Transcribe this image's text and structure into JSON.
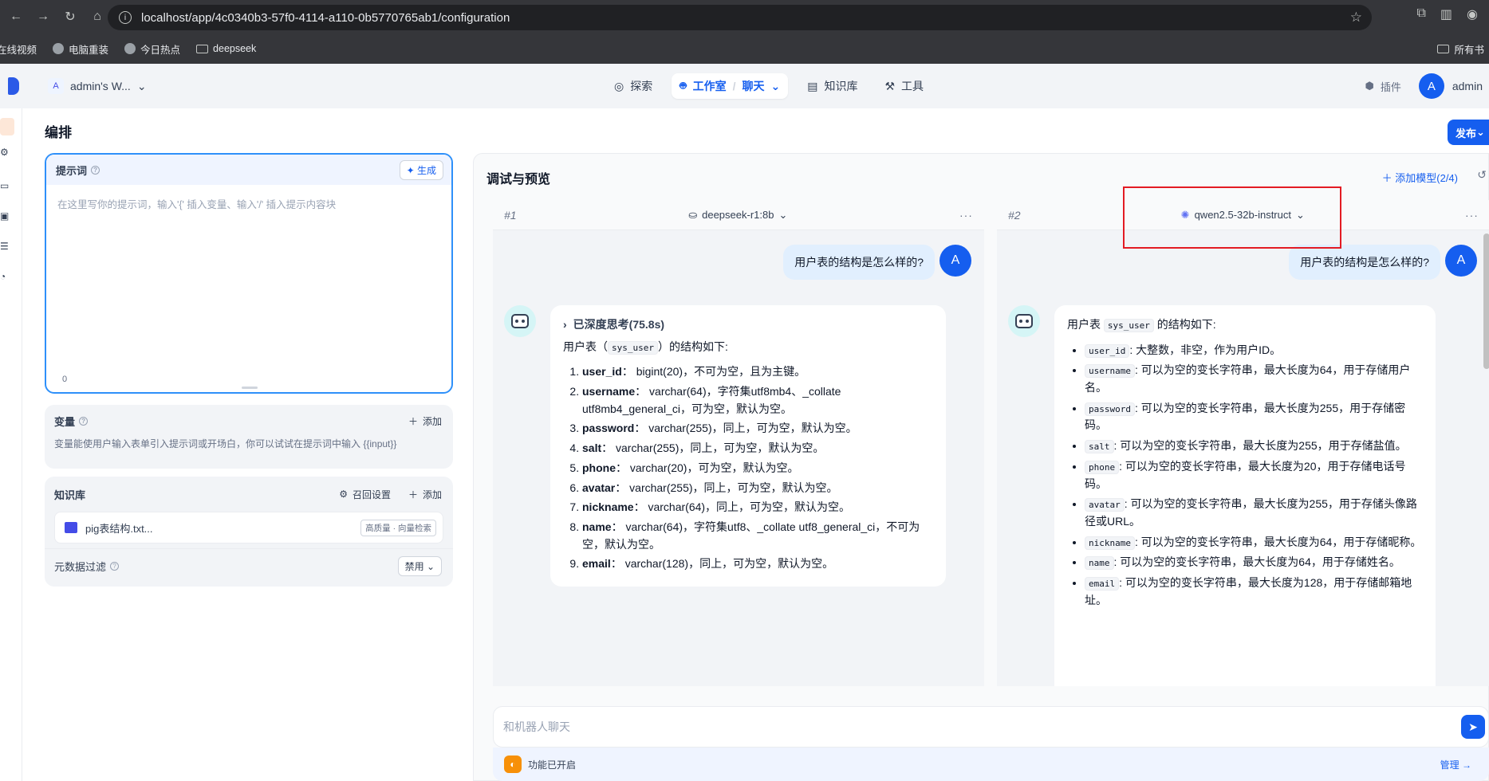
{
  "browser": {
    "url": "localhost/app/4c0340b3-57f0-4114-a110-0b5770765ab1/configuration",
    "bookmarks": [
      "在线视频",
      "电脑重装",
      "今日热点",
      "deepseek"
    ],
    "bookmarks_right": "所有书"
  },
  "header": {
    "workspace": "admin's W...",
    "workspace_initial": "A",
    "nav": {
      "explore": "探索",
      "studio": "工作室",
      "chat": "聊天",
      "knowledge": "知识库",
      "tools": "工具"
    },
    "plugins": "插件",
    "user_initial": "A",
    "user_name": "admin"
  },
  "left": {
    "title": "编排",
    "publish": "发布",
    "prompt": {
      "label": "提示词",
      "generate": "生成",
      "placeholder": "在这里写你的提示词，输入'{' 插入变量、输入'/' 插入提示内容块",
      "count": "0"
    },
    "variables": {
      "label": "变量",
      "add": "添加",
      "desc": "变量能使用户输入表单引入提示词或开场白，你可以试试在提示词中输入 {{input}}"
    },
    "knowledge": {
      "label": "知识库",
      "recall": "召回设置",
      "add": "添加",
      "item": "pig表结构.txt...",
      "tag": "高质量 · 向量检索"
    },
    "metadata": {
      "label": "元数据过滤",
      "value": "禁用"
    }
  },
  "debug": {
    "title": "调试与预览",
    "add_model": "添加模型(2/4)",
    "col1": {
      "num": "#1",
      "model": "deepseek-r1:8b",
      "user_q": "用户表的结构是怎么样的?",
      "user_initial": "A",
      "think": "已深度思考(75.8s)",
      "intro_pre": "用户表（",
      "intro_code": "sys_user",
      "intro_post": "）的结构如下:",
      "items": [
        {
          "k": "user_id",
          "v": "： bigint(20)，不可为空，且为主键。"
        },
        {
          "k": "username",
          "v": "： varchar(64)，字符集utf8mb4、_collate utf8mb4_general_ci，可为空，默认为空。"
        },
        {
          "k": "password",
          "v": "： varchar(255)，同上，可为空，默认为空。"
        },
        {
          "k": "salt",
          "v": "： varchar(255)，同上，可为空，默认为空。"
        },
        {
          "k": "phone",
          "v": "： varchar(20)，可为空，默认为空。"
        },
        {
          "k": "avatar",
          "v": "： varchar(255)，同上，可为空，默认为空。"
        },
        {
          "k": "nickname",
          "v": "： varchar(64)，同上，可为空，默认为空。"
        },
        {
          "k": "name",
          "v": "： varchar(64)，字符集utf8、_collate utf8_general_ci，不可为空，默认为空。"
        },
        {
          "k": "email",
          "v": "： varchar(128)，同上，可为空，默认为空。"
        }
      ]
    },
    "col2": {
      "num": "#2",
      "model": "qwen2.5-32b-instruct",
      "user_q": "用户表的结构是怎么样的?",
      "user_initial": "A",
      "intro_pre": "用户表",
      "intro_code": "sys_user",
      "intro_post": "的结构如下:",
      "items": [
        {
          "k": "user_id",
          "v": ": 大整数，非空，作为用户ID。"
        },
        {
          "k": "username",
          "v": ": 可以为空的变长字符串，最大长度为64，用于存储用户名。"
        },
        {
          "k": "password",
          "v": ": 可以为空的变长字符串，最大长度为255，用于存储密码。"
        },
        {
          "k": "salt",
          "v": ": 可以为空的变长字符串，最大长度为255，用于存储盐值。"
        },
        {
          "k": "phone",
          "v": ": 可以为空的变长字符串，最大长度为20，用于存储电话号码。"
        },
        {
          "k": "avatar",
          "v": ": 可以为空的变长字符串，最大长度为255，用于存储头像路径或URL。"
        },
        {
          "k": "nickname",
          "v": ": 可以为空的变长字符串，最大长度为64，用于存储昵称。"
        },
        {
          "k": "name",
          "v": ": 可以为空的变长字符串，最大长度为64，用于存储姓名。"
        },
        {
          "k": "email",
          "v": ": 可以为空的变长字符串，最大长度为128，用于存储邮箱地址。"
        }
      ]
    },
    "input_placeholder": "和机器人聊天",
    "feature_text": "功能已开启",
    "manage": "管理"
  },
  "colors": {
    "accent": "#155eef",
    "highlight_box": "#e31b23"
  },
  "icons": [
    "back-icon",
    "forward-icon",
    "reload-icon",
    "home-icon",
    "star-icon",
    "extensions-icon",
    "sidepanel-icon",
    "profile-icon",
    "explore-icon",
    "robot-icon",
    "book-icon",
    "tool-icon",
    "plugin-icon",
    "sparkle-icon",
    "send-icon"
  ]
}
